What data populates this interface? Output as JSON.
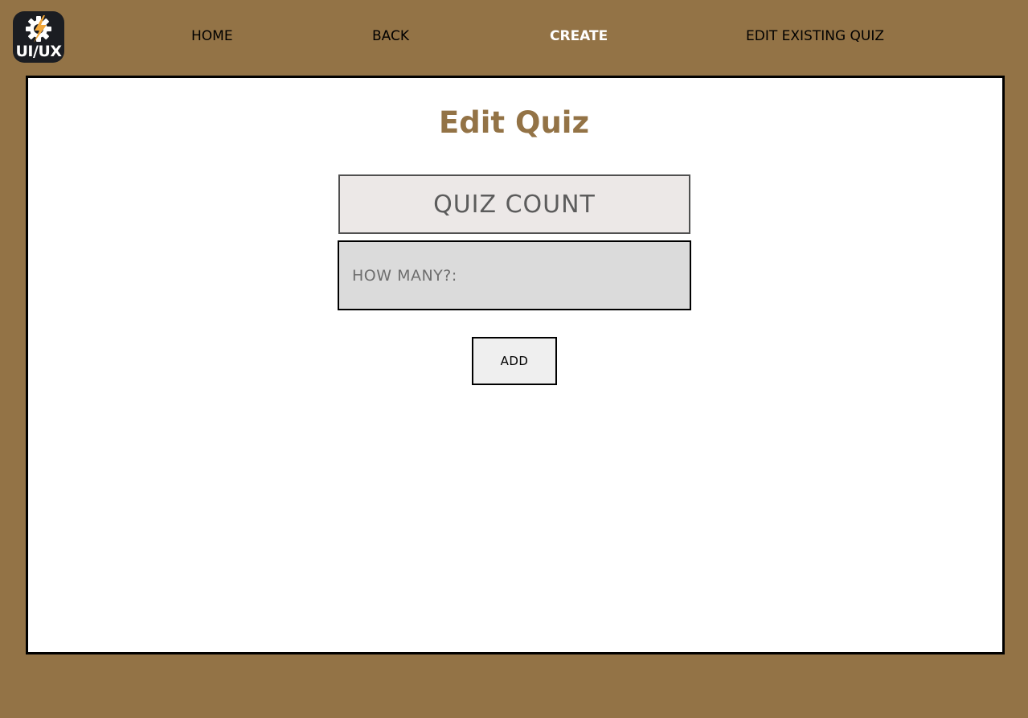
{
  "logo": {
    "text": "UI/UX",
    "icon": "gear-lightning-icon",
    "colors": {
      "background": "#1b1d22",
      "gear": "#ffffff",
      "bolt": "#f0a63a"
    }
  },
  "nav": {
    "items": [
      {
        "label": "HOME",
        "active": false
      },
      {
        "label": "BACK",
        "active": false
      },
      {
        "label": "CREATE",
        "active": true
      },
      {
        "label": "EDIT EXISTING QUIZ",
        "active": false
      }
    ]
  },
  "main": {
    "title": "Edit Quiz",
    "quiz_count_label": "QUIZ COUNT",
    "how_many": {
      "value": "",
      "placeholder": "HOW MANY?:"
    },
    "add_label": "ADD"
  },
  "theme": {
    "background": "#937346",
    "title_color": "#937346",
    "active_nav_color": "#ffffff",
    "panel_background": "#ffffff"
  }
}
